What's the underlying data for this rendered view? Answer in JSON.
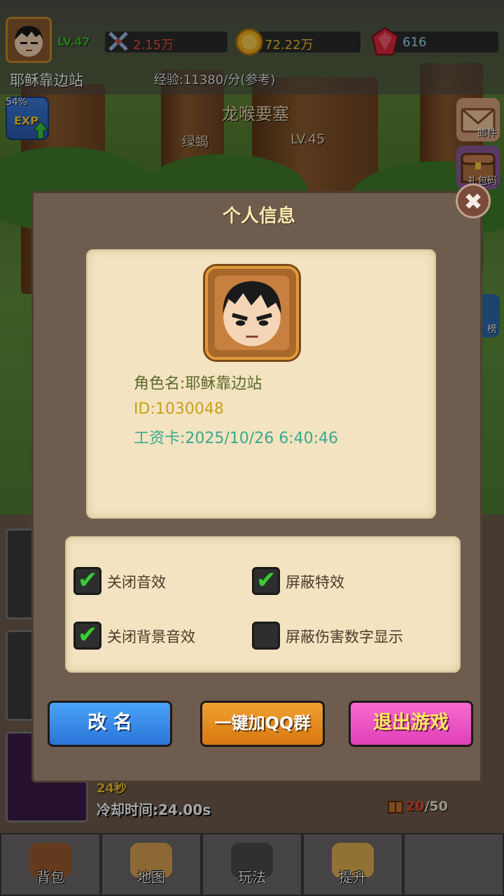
{
  "hud": {
    "level": "LV.47",
    "power": "2.15万",
    "gold": "72.22万",
    "gems": "616",
    "player_name": "耶稣靠边站",
    "exp_info": "经验:11380/分(参考)",
    "exp_percent": "54%",
    "exp_badge_label": "EXP"
  },
  "scene": {
    "area_name": "龙喉要塞",
    "enemy_name": "绿蝎",
    "enemy_level": "LV.45"
  },
  "side_menu": {
    "mail_label": "邮件",
    "gift_code_label": "礼包码",
    "rank_label": "榜"
  },
  "lower": {
    "seconds": "24秒",
    "cooldown": "冷却时间:24.00s",
    "bag_current": "20",
    "bag_max": "/50"
  },
  "dialog": {
    "title": "个人信息",
    "role_name": "角色名:耶稣靠边站",
    "id_line": "ID:1030048",
    "salary_line": "工资卡:2025/10/26 6:40:46",
    "options": [
      {
        "label": "关闭音效",
        "checked": true
      },
      {
        "label": "屏蔽特效",
        "checked": true
      },
      {
        "label": "关闭背景音效",
        "checked": true
      },
      {
        "label": "屏蔽伤害数字显示",
        "checked": false
      }
    ],
    "checkmark": "✔",
    "rename_label": "改 名",
    "qq_label": "一键加QQ群",
    "quit_label": "退出游戏",
    "close_symbol": "✖"
  },
  "nav": {
    "bag": "背包",
    "map": "地图",
    "play": "玩法",
    "upgrade": "提升"
  },
  "colors": {
    "rename": "#2a74d8",
    "qq": "#d87810",
    "quit": "#e040b8",
    "check": "#3ec83a"
  }
}
